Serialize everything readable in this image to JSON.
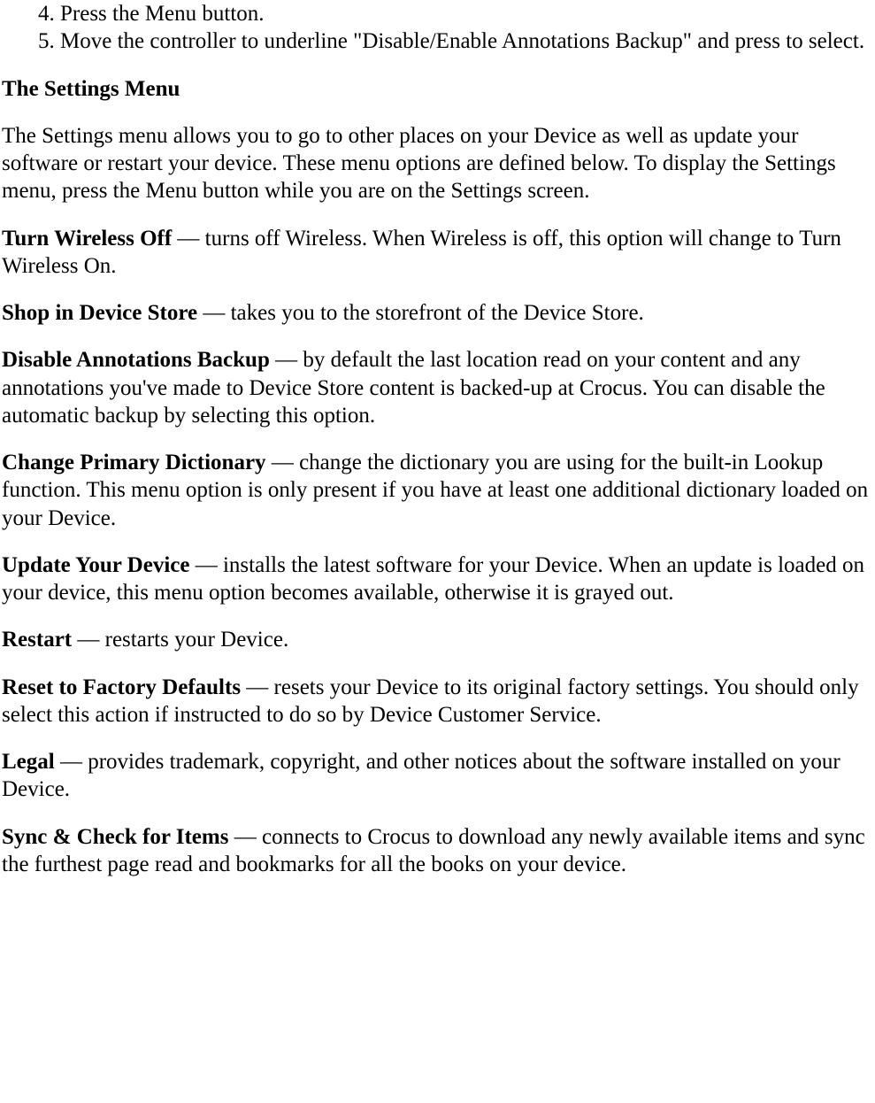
{
  "list": {
    "start": 4,
    "items": [
      "Press the Menu button.",
      "Move the controller to underline \"Disable/Enable Annotations Backup\" and press to select."
    ]
  },
  "heading": "The Settings Menu",
  "intro": "The Settings menu allows you to go to other places on your Device as well as update your software or restart your device. These menu options are defined below. To display the Settings menu, press the Menu button while you are on the Settings screen.",
  "entries": [
    {
      "term": "Turn Wireless Off",
      "sep": " — ",
      "desc": "turns off Wireless. When Wireless is off, this option will change to Turn Wireless On."
    },
    {
      "term": "Shop in Device Store",
      "sep": " — ",
      "desc": "takes you to the storefront of the Device Store."
    },
    {
      "term": "Disable Annotations Backup",
      "sep": " — ",
      "desc": "by default the last location read on your content and any annotations you've made to Device Store content is backed-up at Crocus. You can disable the automatic backup by selecting this option."
    },
    {
      "term": "Change Primary Dictionary",
      "sep": " — ",
      "desc": "change the dictionary you are using for the built-in Lookup function. This menu option is only present if you have at least one additional dictionary loaded on your Device."
    },
    {
      "term": "Update Your Device",
      "sep": " — ",
      "desc": "installs the latest software for your Device. When an update is loaded on your device, this menu option becomes available, otherwise it is grayed out."
    },
    {
      "term": "Restart",
      "sep": " — ",
      "desc": "restarts your Device."
    },
    {
      "term": "Reset to Factory Defaults",
      "sep": " — ",
      "desc": "resets your Device to its original factory settings. You should only select this action if instructed to do so by Device Customer Service."
    },
    {
      "term": "Legal",
      "sep": " — ",
      "desc": "provides trademark, copyright, and other notices about the software installed on your Device."
    },
    {
      "term": "Sync & Check for Items",
      "sep": " — ",
      "desc": "connects to Crocus to download any newly available items and sync the furthest page read and bookmarks for all the books on your device."
    }
  ]
}
